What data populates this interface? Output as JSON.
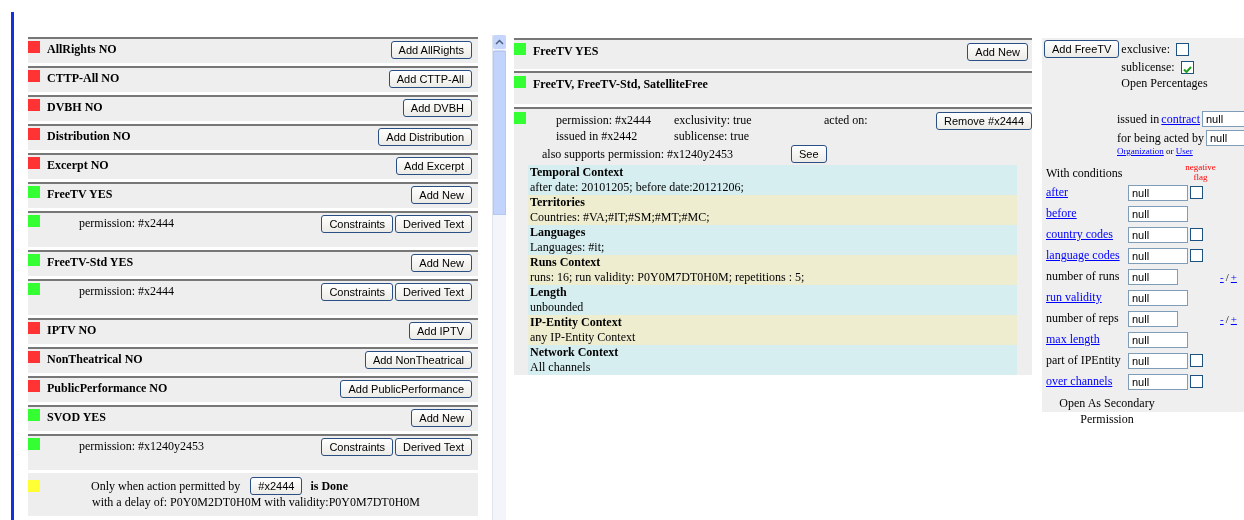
{
  "left_panel": {
    "items": [
      {
        "kind": "right",
        "color": "#ff3333",
        "title": "AllRights NO",
        "button": "Add AllRights"
      },
      {
        "kind": "right",
        "color": "#ff3333",
        "title": "CTTP-All NO",
        "button": "Add CTTP-All"
      },
      {
        "kind": "right",
        "color": "#ff3333",
        "title": "DVBH NO",
        "button": "Add DVBH"
      },
      {
        "kind": "right",
        "color": "#ff3333",
        "title": "Distribution NO",
        "button": "Add Distribution"
      },
      {
        "kind": "right",
        "color": "#ff3333",
        "title": "Excerpt NO",
        "button": "Add Excerpt"
      },
      {
        "kind": "right",
        "color": "#33ff33",
        "title": "FreeTV YES",
        "button": "Add New"
      },
      {
        "kind": "permission",
        "color": "#33ff33",
        "text": "permission: #x2444",
        "buttons": [
          "Constraints",
          "Derived Text"
        ]
      },
      {
        "kind": "right",
        "color": "#33ff33",
        "title": "FreeTV-Std YES",
        "button": "Add New"
      },
      {
        "kind": "permission",
        "color": "#33ff33",
        "text": "permission: #x2444",
        "buttons": [
          "Constraints",
          "Derived Text"
        ]
      },
      {
        "kind": "right",
        "color": "#ff3333",
        "title": "IPTV NO",
        "button": "Add IPTV"
      },
      {
        "kind": "right",
        "color": "#ff3333",
        "title": "NonTheatrical NO",
        "button": "Add NonTheatrical"
      },
      {
        "kind": "right",
        "color": "#ff3333",
        "title": "PublicPerformance NO",
        "button": "Add PublicPerformance"
      },
      {
        "kind": "right",
        "color": "#33ff33",
        "title": "SVOD YES",
        "button": "Add New"
      },
      {
        "kind": "permission",
        "color": "#33ff33",
        "text": "permission: #x1240y2453",
        "buttons": [
          "Constraints",
          "Derived Text"
        ]
      },
      {
        "kind": "condition",
        "color": "#ffff33",
        "text": "Only when action permitted by",
        "button": "#x2444",
        "status": "is Done",
        "detail": "with a delay of: P0Y0M2DT0H0M with validity:P0Y0M7DT0H0M"
      }
    ]
  },
  "middle_panel": {
    "headers": [
      {
        "color": "#33ff33",
        "title": "FreeTV YES",
        "button": "Add New"
      },
      {
        "color": "#33ff33",
        "title": "FreeTV, FreeTV-Std, SatelliteFree"
      }
    ],
    "permission": {
      "color": "#33ff33",
      "id": "permission: #x2444",
      "exclusivity": "exclusivity: true",
      "acted_on": "acted on:",
      "issued": "issued in #x2442",
      "sublicense": "sublicense: true",
      "supports": "also supports permission: #x1240y2453",
      "see_button": "See",
      "remove_button": "Remove #x2444"
    },
    "contexts": [
      {
        "title": "Temporal Context",
        "text": "after date: 20101205; before date:20121206;"
      },
      {
        "title": "Territories",
        "text": "Countries: #VA;#IT;#SM;#MT;#MC;"
      },
      {
        "title": "Languages",
        "text": "Languages: #it;"
      },
      {
        "title": "Runs Context",
        "text": "runs: 16; run validity: P0Y0M7DT0H0M; repetitions : 5;"
      },
      {
        "title": "Length",
        "text": "unbounded"
      },
      {
        "title": "IP-Entity Context",
        "text": "any IP-Entity Context"
      },
      {
        "title": "Network Context",
        "text": "All channels"
      }
    ]
  },
  "right_panel": {
    "add_button": "Add FreeTV",
    "exclusive": {
      "label": "exclusive:",
      "checked": false
    },
    "sublicense": {
      "label": "sublicense:",
      "checked": true
    },
    "open_percentages": "Open Percentages",
    "issued_in": {
      "label": "issued in",
      "link": "contract",
      "value": "null"
    },
    "acted_by": {
      "label": "for being acted by",
      "value": "null"
    },
    "actor_links": [
      "Organization",
      "User"
    ],
    "or": "or",
    "conditions_title": "With conditions",
    "negative_flag": "negative flag",
    "conditions": [
      {
        "label": "after",
        "link": true,
        "value": "null",
        "kind": "checkbox",
        "checked": false
      },
      {
        "label": "before",
        "link": true,
        "value": "null",
        "kind": "plain"
      },
      {
        "label": "country codes",
        "link": true,
        "value": "null",
        "kind": "checkbox",
        "checked": false
      },
      {
        "label": "language codes",
        "link": true,
        "value": "null",
        "kind": "checkbox",
        "checked": false
      },
      {
        "label": "number of runs",
        "link": false,
        "value": "null",
        "kind": "plusminus",
        "minus": "-",
        "sep": "/",
        "plus": "+"
      },
      {
        "label": "run validity",
        "link": true,
        "value": "null",
        "kind": "plain"
      },
      {
        "label": "number of reps",
        "link": false,
        "value": "null",
        "kind": "plusminus",
        "minus": "-",
        "sep": "/",
        "plus": "+"
      },
      {
        "label": "max length",
        "link": true,
        "value": "null",
        "kind": "plain"
      },
      {
        "label": "part of IPEntity",
        "link": false,
        "value": "null",
        "kind": "checkbox",
        "checked": false
      },
      {
        "label": "over channels",
        "link": true,
        "value": "null",
        "kind": "checkbox",
        "checked": false
      }
    ],
    "secondary_button": "Open As Secondary Permission"
  }
}
